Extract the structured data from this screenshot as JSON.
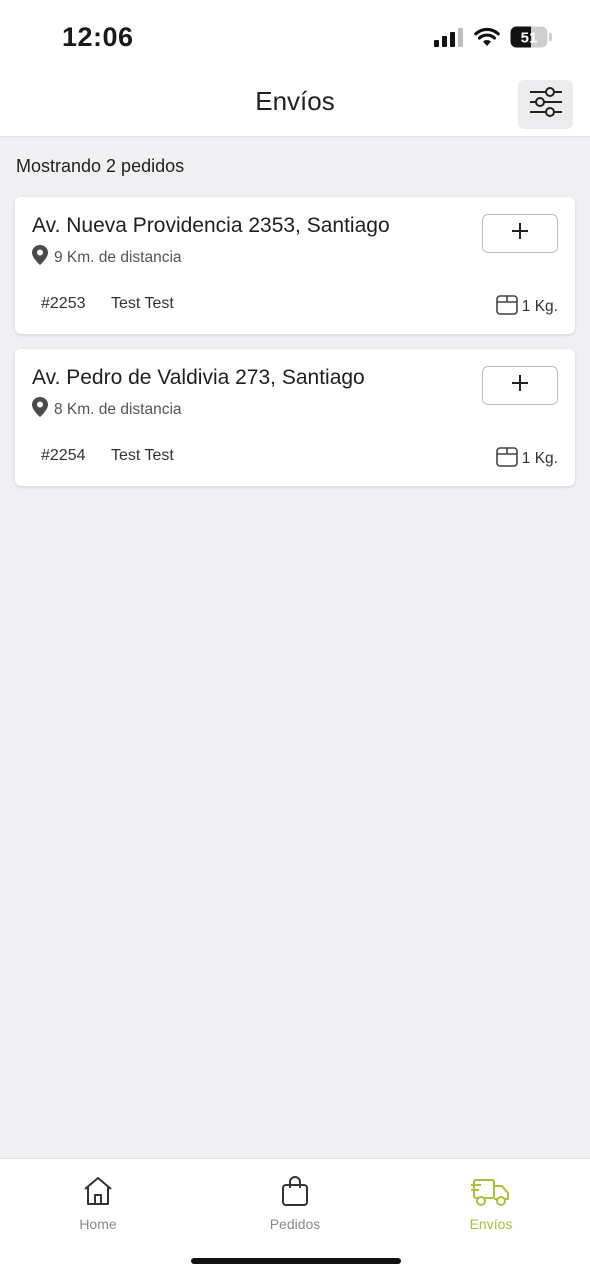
{
  "status_bar": {
    "time": "12:06",
    "battery": "51"
  },
  "header": {
    "title": "Envíos",
    "filter_icon": "sliders-icon"
  },
  "main": {
    "result_count": "Mostrando 2 pedidos",
    "orders": [
      {
        "address": "Av. Nueva Providencia 2353, Santiago",
        "distance": "9 Km. de distancia",
        "order_id": "#2253",
        "customer": "Test Test",
        "weight": "1 Kg.",
        "add_label": "+"
      },
      {
        "address": "Av. Pedro de Valdivia 273, Santiago",
        "distance": "8 Km. de distancia",
        "order_id": "#2254",
        "customer": "Test Test",
        "weight": "1 Kg.",
        "add_label": "+"
      }
    ]
  },
  "bottom_nav": {
    "items": [
      {
        "label": "Home",
        "icon": "home-icon"
      },
      {
        "label": "Pedidos",
        "icon": "shopping-bag-icon"
      },
      {
        "label": "Envíos",
        "icon": "delivery-truck-icon"
      }
    ],
    "active_color": "#a8c13c",
    "inactive_color": "#8a8a8e"
  }
}
